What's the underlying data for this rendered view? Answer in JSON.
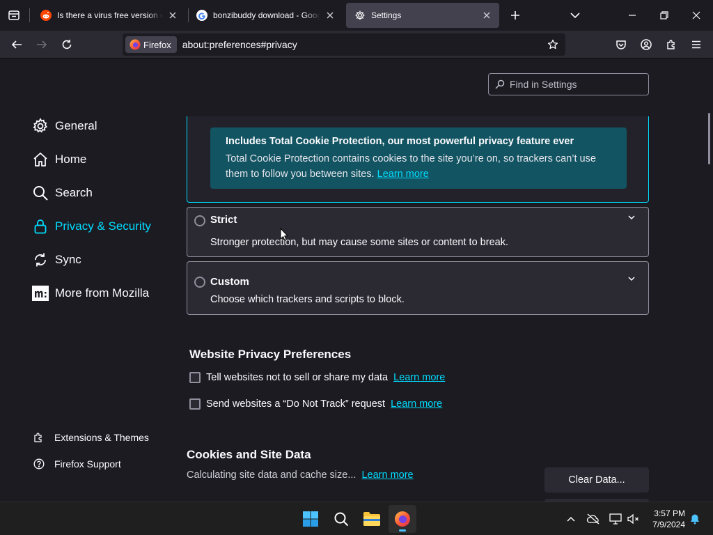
{
  "browser": {
    "tabs": [
      {
        "title": "Is there a virus free version of Bonzi",
        "favicon": "reddit-icon",
        "active": false
      },
      {
        "title": "bonzibuddy download - Google Search",
        "favicon": "google-icon",
        "active": false
      },
      {
        "title": "Settings",
        "favicon": "gear-icon",
        "active": true
      }
    ],
    "identity_label": "Firefox",
    "url": "about:preferences#privacy"
  },
  "settings": {
    "find_placeholder": "Find in Settings",
    "categories": [
      {
        "label": "General",
        "icon": "gear-icon"
      },
      {
        "label": "Home",
        "icon": "home-icon"
      },
      {
        "label": "Search",
        "icon": "search-icon"
      },
      {
        "label": "Privacy & Security",
        "icon": "lock-icon",
        "selected": true
      },
      {
        "label": "Sync",
        "icon": "sync-icon"
      },
      {
        "label": "More from Mozilla",
        "icon": "mozilla-icon"
      }
    ],
    "footer": [
      {
        "label": "Extensions & Themes",
        "icon": "puzzle-icon"
      },
      {
        "label": "Firefox Support",
        "icon": "help-icon"
      }
    ],
    "tcp": {
      "heading": "Includes Total Cookie Protection, our most powerful privacy feature ever",
      "body": "Total Cookie Protection contains cookies to the site you’re on, so trackers can’t use them to follow you between sites.",
      "link": "Learn more"
    },
    "strict": {
      "title": "Strict",
      "desc": "Stronger protection, but may cause some sites or content to break."
    },
    "custom": {
      "title": "Custom",
      "desc": "Choose which trackers and scripts to block."
    },
    "wpp": {
      "heading": "Website Privacy Preferences",
      "items": [
        {
          "label": "Tell websites not to sell or share my data",
          "link": "Learn more",
          "checked": false
        },
        {
          "label": "Send websites a “Do Not Track” request",
          "link": "Learn more",
          "checked": false
        }
      ]
    },
    "cookies": {
      "heading": "Cookies and Site Data",
      "status": "Calculating site data and cache size...",
      "link": "Learn more",
      "clear_button": "Clear Data..."
    }
  },
  "taskbar": {
    "time": "3:57 PM",
    "date": "7/9/2024"
  },
  "colors": {
    "accent": "#00ddff",
    "tcp_background": "#125462",
    "tab_active": "#42414d"
  }
}
